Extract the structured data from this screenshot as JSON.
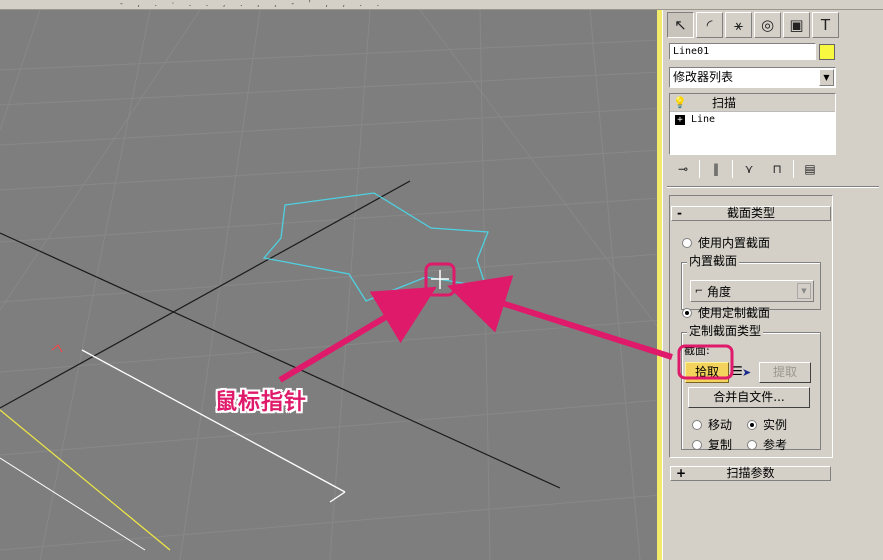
{
  "top_strip_marks": "- , . · . . , . , , - ' , , . .",
  "viewport": {
    "background": "#7e7e7e",
    "shape_color": "#4fd0e0",
    "border_color": "#f2ea6a"
  },
  "panel": {
    "tabs": [
      {
        "icon": "create-icon",
        "glyph": "↖",
        "active": true
      },
      {
        "icon": "modify-icon",
        "glyph": "◜",
        "active": false
      },
      {
        "icon": "hierarchy-icon",
        "glyph": "⚹",
        "active": false
      },
      {
        "icon": "motion-icon",
        "glyph": "◎",
        "active": false
      },
      {
        "icon": "display-icon",
        "glyph": "▣",
        "active": false
      },
      {
        "icon": "utilities-icon",
        "glyph": "T",
        "active": false
      }
    ],
    "object_name": "Line01",
    "object_color": "#f8f840",
    "modifier_list": "修改器列表",
    "stack": {
      "top_item": "扫描",
      "base_item": "Line"
    },
    "stack_tools": [
      {
        "icon": "pin-stack-icon",
        "glyph": "⊸"
      },
      {
        "icon": "show-end-result-icon",
        "glyph": "‖"
      },
      {
        "icon": "make-unique-icon",
        "glyph": "⋎"
      },
      {
        "icon": "remove-modifier-icon",
        "glyph": "⊓"
      },
      {
        "icon": "configure-sets-icon",
        "glyph": "▤"
      }
    ]
  },
  "section_rollout": {
    "sign": "-",
    "title": "截面类型",
    "use_builtin_label": "使用内置截面",
    "builtin_group_label": "内置截面",
    "builtin_value": "角度",
    "use_custom_label": "使用定制截面",
    "custom_group_label": "定制截面类型",
    "section_label": "截面:",
    "pick_button": "拾取",
    "extract_button": "提取",
    "merge_button": "合并自文件...",
    "move_label": "移动",
    "instance_label": "实例",
    "copy_label": "复制",
    "reference_label": "参考"
  },
  "sweep_params_rollout": {
    "sign": "+",
    "title": "扫描参数"
  },
  "annotation": {
    "text": "鼠标指针",
    "color": "#e01a6a"
  }
}
